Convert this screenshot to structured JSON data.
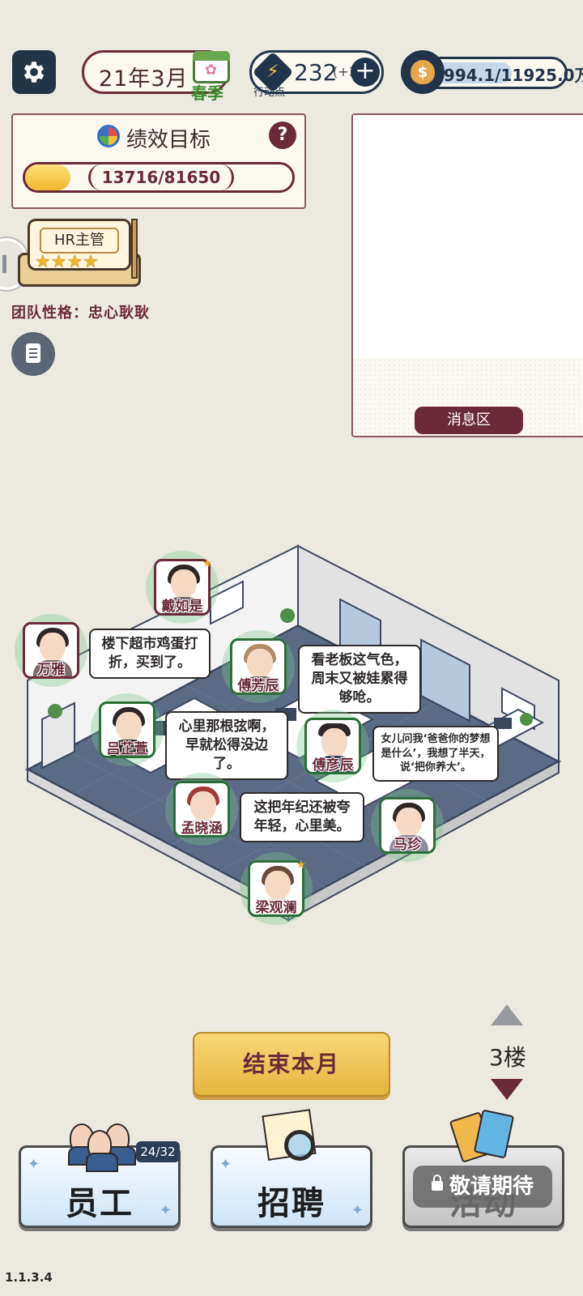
{
  "top_bar": {
    "date": "21年3月",
    "season": "春季",
    "action_points": "232",
    "action_points_rate": "(+3",
    "action_points_label": "行动点",
    "money": "6994.1/11925.0万",
    "money_symbol": "$"
  },
  "performance": {
    "title": "绩效目标",
    "help": "?",
    "current": 13716,
    "target": 81650,
    "progress_text": "13716/81650",
    "progress_fraction": 0.168
  },
  "hr_badge": {
    "label": "HR主管",
    "stars": "★★★★"
  },
  "team_trait": "团队性格：忠心耿耿",
  "message_area": {
    "label": "消息区"
  },
  "employees": [
    {
      "name": "戴如是"
    },
    {
      "name": "万雅"
    },
    {
      "name": "傅芳辰"
    },
    {
      "name": "吕芷萱"
    },
    {
      "name": "傅彦辰"
    },
    {
      "name": "孟晓涵"
    },
    {
      "name": "马珍"
    },
    {
      "name": "梁观澜"
    }
  ],
  "speech": {
    "wanya": "楼下超市鸡蛋打折，买到了。",
    "fufangchen": "看老板这气色，周末又被娃累得够呛。",
    "lvzhixuan": "心里那根弦啊，早就松得没边了。",
    "fuyanchen": "女儿问我‘爸爸你的梦想是什么’，我想了半天，说‘把你养大’。",
    "mengxiaohan": "这把年纪还被夸年轻，心里美。"
  },
  "floor": {
    "label": "3楼"
  },
  "end_month_label": "结束本月",
  "bottom": {
    "employee_label": "员工",
    "employee_count": "24/32",
    "recruit_label": "招聘",
    "activity_label": "活动",
    "coming_soon": "敬请期待"
  },
  "version": "1.1.3.4",
  "colors": {
    "accent": "#6b2a3a",
    "navy": "#22344a",
    "gold": "#f0b72f",
    "background": "#ebe9e0"
  }
}
